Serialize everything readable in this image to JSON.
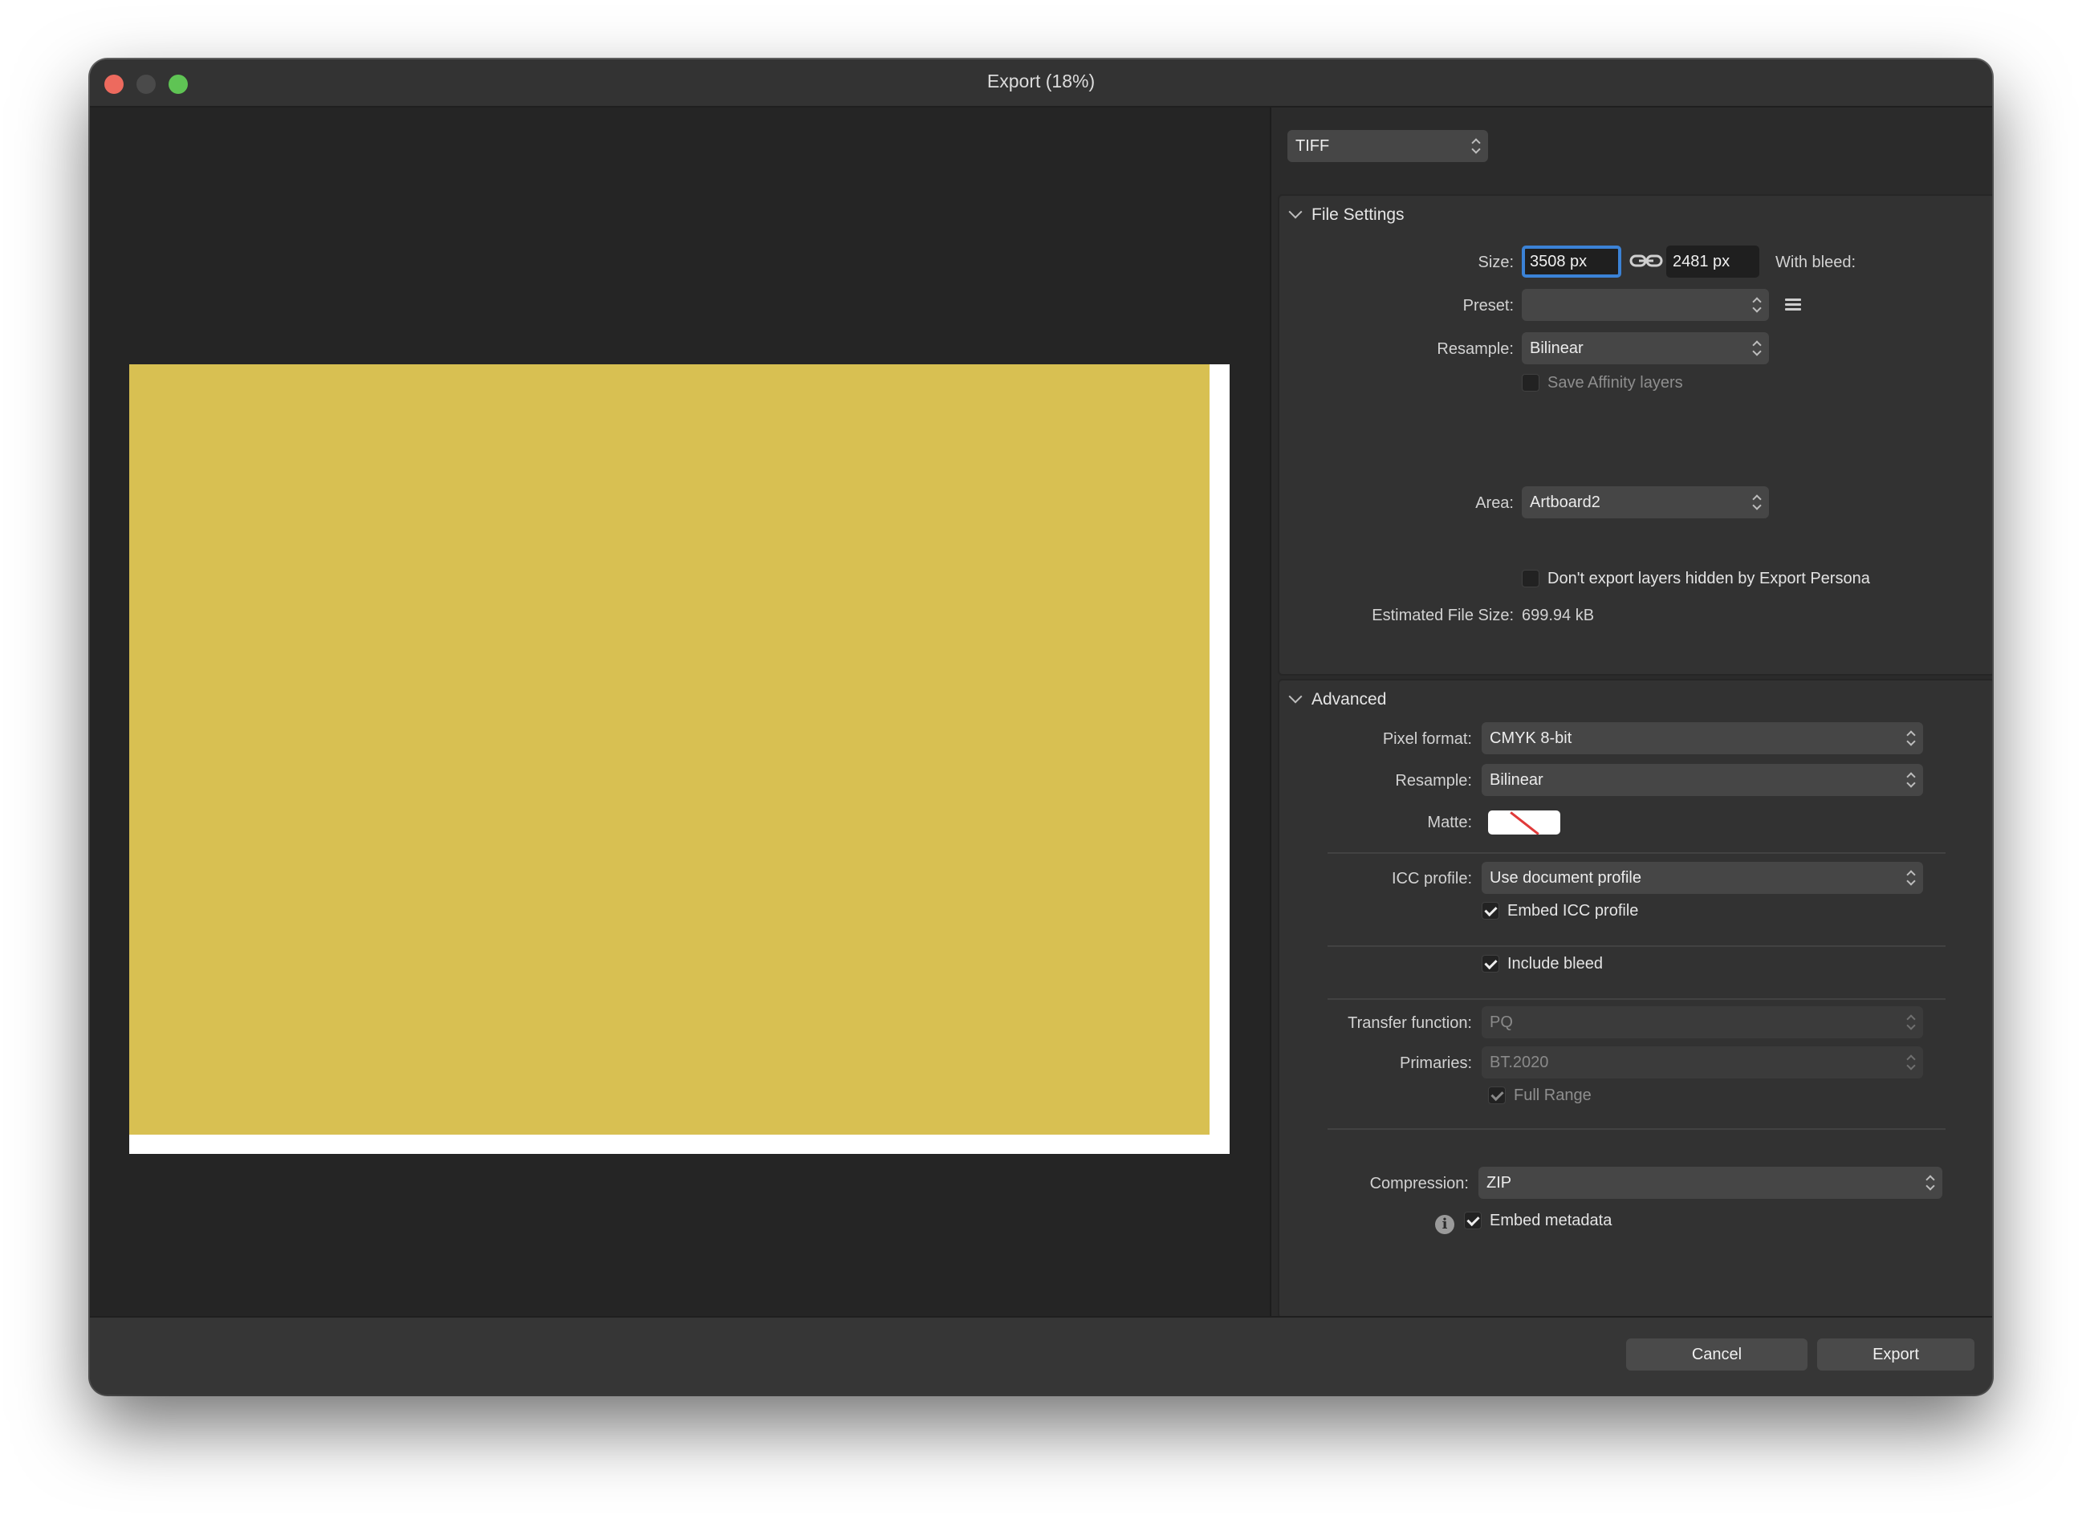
{
  "window": {
    "title": "Export (18%)"
  },
  "format": {
    "value": "TIFF"
  },
  "file_settings": {
    "header": "File Settings",
    "size_label": "Size:",
    "width": "3508 px",
    "height": "2481 px",
    "with_bleed_label": "With bleed:",
    "preset_label": "Preset:",
    "preset_value": "",
    "resample_label": "Resample:",
    "resample_value": "Bilinear",
    "save_affinity_layers": "Save Affinity layers",
    "area_label": "Area:",
    "area_value": "Artboard2",
    "dont_export_hidden": "Don't export layers hidden by Export Persona",
    "estimated_label": "Estimated File Size:",
    "estimated_value": "699.94 kB"
  },
  "advanced": {
    "header": "Advanced",
    "pixel_format_label": "Pixel format:",
    "pixel_format_value": "CMYK 8-bit",
    "resample_label": "Resample:",
    "resample_value": "Bilinear",
    "matte_label": "Matte:",
    "icc_label": "ICC profile:",
    "icc_value": "Use document profile",
    "embed_icc": "Embed ICC profile",
    "include_bleed": "Include bleed",
    "transfer_label": "Transfer function:",
    "transfer_value": "PQ",
    "primaries_label": "Primaries:",
    "primaries_value": "BT.2020",
    "full_range": "Full Range",
    "compression_label": "Compression:",
    "compression_value": "ZIP",
    "embed_metadata": "Embed metadata"
  },
  "footer": {
    "cancel": "Cancel",
    "export": "Export"
  },
  "colors": {
    "artboard": "#d8c052",
    "focus": "#3b82d6",
    "close": "#ed6a5e",
    "maximize": "#5fc454"
  }
}
